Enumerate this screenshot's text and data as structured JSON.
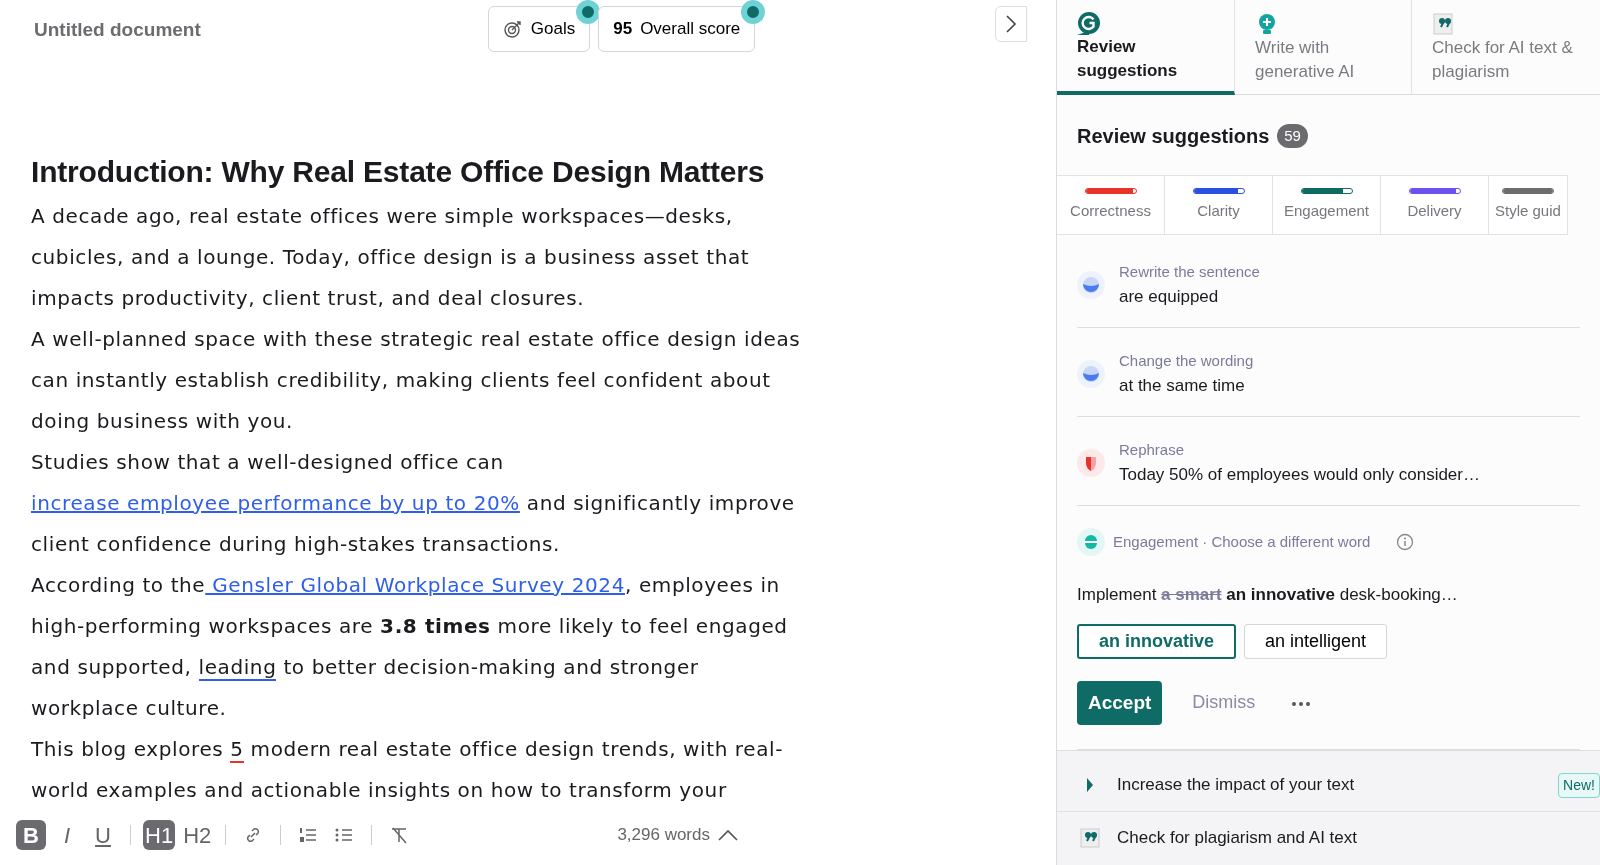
{
  "document": {
    "title": "Untitled document",
    "goals_button": {
      "label": "Goals",
      "notification": true
    },
    "score_button": {
      "score": "95",
      "label": "Overall score",
      "notification": true
    },
    "heading": "Introduction: Why Real Estate Office Design Matters",
    "paragraphs": [
      [
        {
          "kind": "plain",
          "text": "A decade ago, real estate offices were simple workspaces—desks, cubicles, and a lounge. Today, office design is a business asset that impacts productivity, client trust, and deal closures."
        }
      ],
      [
        {
          "kind": "plain",
          "text": "A well-planned space with these strategic real estate office design ideas can instantly establish credibility, making clients feel confident about doing business with you."
        }
      ],
      [
        {
          "kind": "plain",
          "text": "Studies show that a well-designed office can"
        },
        {
          "kind": "link",
          "text": " increase employee performance by up to 20%"
        },
        {
          "kind": "plain",
          "text": " and significantly improve client confidence during high-stakes transactions."
        }
      ],
      [
        {
          "kind": "plain",
          "text": "According to the"
        },
        {
          "kind": "link",
          "text": " Gensler Global Workplace Survey 2024"
        },
        {
          "kind": "plain",
          "text": ", employees in high-performing workspaces are "
        },
        {
          "kind": "bold",
          "text": "3.8 times"
        },
        {
          "kind": "plain",
          "text": " more likely to feel engaged and supported, "
        },
        {
          "kind": "flag",
          "text": "leading",
          "color": "#2f5ee8"
        },
        {
          "kind": "plain",
          "text": " to better decision-making and stronger workplace culture."
        }
      ],
      [
        {
          "kind": "plain",
          "text": "This blog explores "
        },
        {
          "kind": "flag",
          "text": "5",
          "color": "#e8332a"
        },
        {
          "kind": "plain",
          "text": " modern real estate office design trends, with real-world examples and actionable insights on how to transform your"
        }
      ]
    ],
    "toolbar": [
      [
        {
          "kind": "bold",
          "label": "B",
          "active": true
        },
        {
          "kind": "italic",
          "label": "I",
          "active": false
        },
        {
          "kind": "underline",
          "label": "U",
          "active": false
        }
      ],
      [
        {
          "kind": "h1",
          "label": "H1",
          "active": true
        },
        {
          "kind": "h2",
          "label": "H2",
          "active": false
        }
      ],
      [
        {
          "kind": "link",
          "active": false
        }
      ],
      [
        {
          "kind": "numbered-list",
          "active": false
        },
        {
          "kind": "bullet-list",
          "active": false
        }
      ],
      [
        {
          "kind": "clear-format",
          "active": false
        }
      ]
    ],
    "word_count": "3,296 words"
  },
  "panel": {
    "tabs": [
      {
        "kind": "review",
        "label": "Review suggestions",
        "selected": true
      },
      {
        "kind": "write",
        "label": "Write with generative AI",
        "selected": false
      },
      {
        "kind": "check",
        "label": "Check for AI text & plagiarism",
        "selected": false
      }
    ],
    "heading": "Review suggestions",
    "count": "59",
    "categories": [
      {
        "label": "Correctness",
        "color": "#e8332a",
        "level": 0.95
      },
      {
        "label": "Clarity",
        "color": "#2b4fe0",
        "level": 0.88
      },
      {
        "label": "Engagement",
        "color": "#0d6b61",
        "level": 0.83
      },
      {
        "label": "Delivery",
        "color": "#6b52ef",
        "level": 0.92
      },
      {
        "label": "Style guid",
        "color": "#6d6d6d",
        "level": 1
      }
    ],
    "suggestions": [
      {
        "kind": "clarity",
        "title": "Rewrite the sentence",
        "text": "are equipped"
      },
      {
        "kind": "clarity",
        "title": "Change the wording",
        "text": "at the same time"
      },
      {
        "kind": "correctness",
        "title": "Rephrase",
        "text": "Today 50% of employees would only consider…"
      }
    ],
    "active_card": {
      "kind": "engagement",
      "title": "Engagement · Choose a different word",
      "sentence": [
        {
          "kind": "plain",
          "text": "Implement "
        },
        {
          "kind": "removed",
          "text": "a smart"
        },
        {
          "kind": "added",
          "text": " an innovative"
        },
        {
          "kind": "plain",
          "text": " desk-booking…"
        }
      ],
      "options": [
        {
          "label": "an innovative",
          "selected": true
        },
        {
          "label": "an intelligent",
          "selected": false
        }
      ],
      "accept": "Accept",
      "dismiss": "Dismiss"
    },
    "extras": [
      {
        "kind": "impact",
        "label": "Increase the impact of your text",
        "badge": "New!"
      },
      {
        "kind": "plagiarism",
        "label": "Check for plagiarism and AI text"
      }
    ]
  }
}
